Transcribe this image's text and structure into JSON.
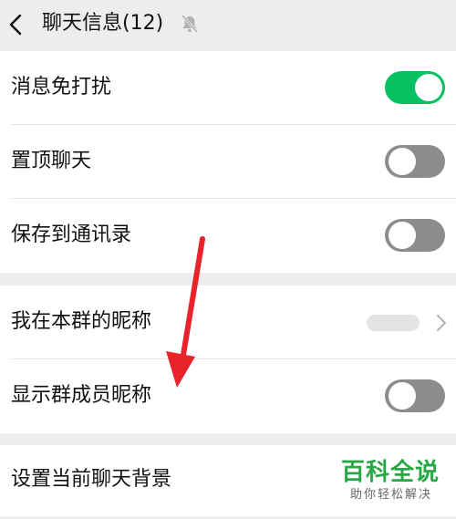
{
  "header": {
    "back_icon": "chevron-left-icon",
    "title": "聊天信息(12)",
    "mute_icon": "bell-slash-icon"
  },
  "settings_top": [
    {
      "label": "消息免打扰",
      "toggle": "on"
    },
    {
      "label": "置顶聊天",
      "toggle": "off"
    },
    {
      "label": "保存到通讯录",
      "toggle": "off"
    }
  ],
  "settings_group": {
    "my_nickname_label": "我在本群的昵称",
    "show_member_nicknames_label": "显示群成员昵称",
    "show_member_nicknames_toggle": "off"
  },
  "settings_bottom": {
    "background_label": "设置当前聊天背景"
  },
  "colors": {
    "toggle_on": "#07c160",
    "toggle_off": "#8c8c8c",
    "arrow": "#e8232c",
    "watermark": "#27a844"
  },
  "watermark": {
    "title": "百科全说",
    "subtitle": "助你轻松解决"
  }
}
